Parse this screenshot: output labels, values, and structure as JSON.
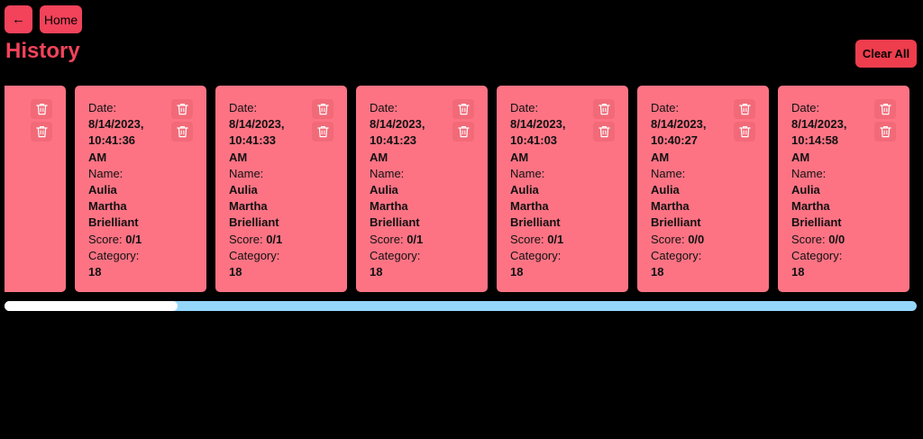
{
  "header": {
    "back_icon": "arrow-left-icon",
    "back_glyph": "←",
    "home_label": "Home",
    "title": "History",
    "clear_label": "Clear All"
  },
  "colors": {
    "accent": "#f2435b",
    "card_background": "#fd7384",
    "scroll_track": "#94d7fb",
    "scroll_thumb": "#ffffff"
  },
  "card_labels": {
    "date": "Date:",
    "name": "Name:",
    "score": "Score:",
    "category": "Category:"
  },
  "icons": {
    "delete": "trash-icon"
  },
  "history": [
    {
      "date_lines": [
        "",
        "",
        ""
      ],
      "name_lines": [
        "",
        "",
        ""
      ],
      "score": "",
      "category": ""
    },
    {
      "date_lines": [
        "8/14/2023,",
        "10:41:36",
        "AM"
      ],
      "name_lines": [
        "Aulia",
        "Martha",
        "Brielliant"
      ],
      "score": "0/1",
      "category": "18"
    },
    {
      "date_lines": [
        "8/14/2023,",
        "10:41:33",
        "AM"
      ],
      "name_lines": [
        "Aulia",
        "Martha",
        "Brielliant"
      ],
      "score": "0/1",
      "category": "18"
    },
    {
      "date_lines": [
        "8/14/2023,",
        "10:41:23",
        "AM"
      ],
      "name_lines": [
        "Aulia",
        "Martha",
        "Brielliant"
      ],
      "score": "0/1",
      "category": "18"
    },
    {
      "date_lines": [
        "8/14/2023,",
        "10:41:03",
        "AM"
      ],
      "name_lines": [
        "Aulia",
        "Martha",
        "Brielliant"
      ],
      "score": "0/1",
      "category": "18"
    },
    {
      "date_lines": [
        "8/14/2023,",
        "10:40:27",
        "AM"
      ],
      "name_lines": [
        "Aulia",
        "Martha",
        "Brielliant"
      ],
      "score": "0/0",
      "category": "18"
    },
    {
      "date_lines": [
        "8/14/2023,",
        "10:14:58",
        "AM"
      ],
      "name_lines": [
        "Aulia",
        "Martha",
        "Brielliant"
      ],
      "score": "0/0",
      "category": "18"
    }
  ],
  "scroll": {
    "position_fraction": 0.19
  }
}
